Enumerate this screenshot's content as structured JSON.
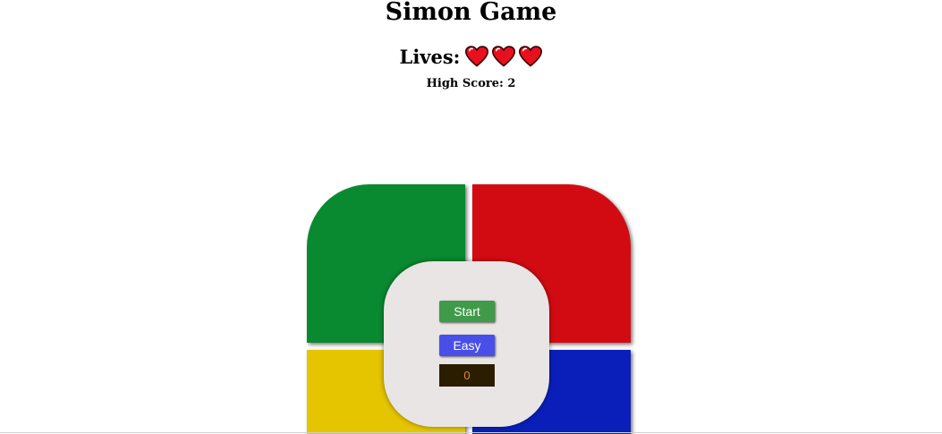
{
  "title": "Simon Game",
  "lives": {
    "label": "Lives:",
    "count": 3,
    "icon": "heart-icon",
    "heart_color": "#e8101e"
  },
  "high_score": {
    "label": "High Score: 2"
  },
  "pads": {
    "green": "#098a31",
    "red": "#d20b12",
    "yellow": "#e5c500",
    "blue": "#0a1fba"
  },
  "controls": {
    "start_label": "Start",
    "start_color": "#3f9b49",
    "mode_label": "Easy",
    "mode_color": "#4a4ee8",
    "counter_value": "0"
  }
}
